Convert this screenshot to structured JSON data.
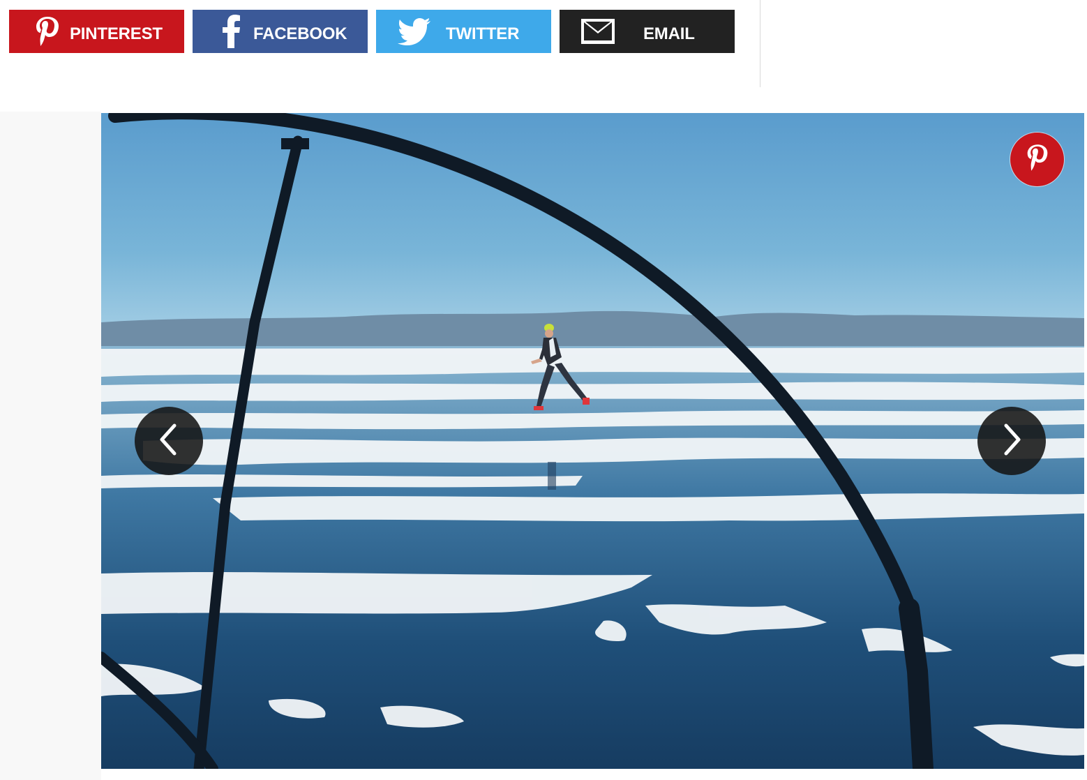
{
  "share": {
    "pinterest": {
      "label": "PINTEREST",
      "color": "#c8161d",
      "icon": "pinterest-icon"
    },
    "facebook": {
      "label": "FACEBOOK",
      "color": "#3b5998",
      "icon": "facebook-icon"
    },
    "twitter": {
      "label": "TWITTER",
      "color": "#3ea9ea",
      "icon": "twitter-icon"
    },
    "email": {
      "label": "EMAIL",
      "color": "#222222",
      "icon": "envelope-icon"
    }
  },
  "slideshow": {
    "image_alt": "Runner crossing frozen lake ice viewed through a curved metal rail",
    "prev_icon": "chevron-left-icon",
    "next_icon": "chevron-right-icon",
    "pin_icon": "pinterest-icon",
    "pin_color": "#c8161d"
  }
}
